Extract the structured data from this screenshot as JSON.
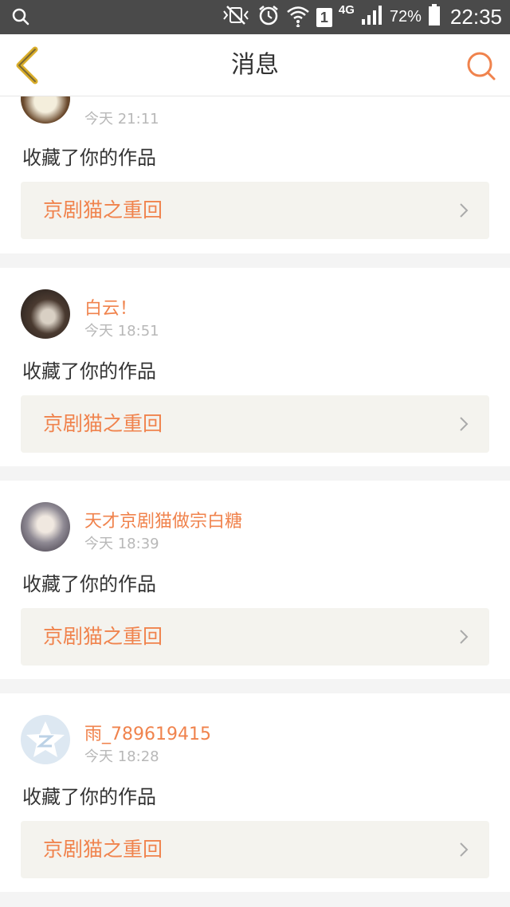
{
  "status_bar": {
    "battery": "72%",
    "network": "4G",
    "sim": "1",
    "time": "22:35"
  },
  "header": {
    "title": "消息"
  },
  "messages": [
    {
      "username": "",
      "time": "今天 21:11",
      "action": "收藏了你的作品",
      "work_title": "京剧猫之重回"
    },
    {
      "username": "白云！",
      "time": "今天 18:51",
      "action": "收藏了你的作品",
      "work_title": "京剧猫之重回"
    },
    {
      "username": "天才京剧猫做宗白糖",
      "time": "今天 18:39",
      "action": "收藏了你的作品",
      "work_title": "京剧猫之重回"
    },
    {
      "username": "雨_789619415",
      "time": "今天 18:28",
      "action": "收藏了你的作品",
      "work_title": "京剧猫之重回"
    }
  ],
  "colors": {
    "accent": "#f0834d",
    "back_arrow": "#d9ad2a",
    "status_bar_bg": "#4a4a4a",
    "link_bg": "#f4f3ee"
  }
}
